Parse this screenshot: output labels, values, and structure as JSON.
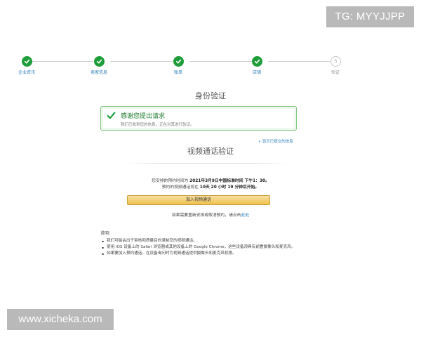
{
  "watermarks": {
    "tg": "TG: MYYJJPP",
    "site": "www.xicheka.com"
  },
  "colors": {
    "success": "#1f9d3a",
    "link": "#2a7fbf",
    "button": "#f0c14b"
  },
  "steps": [
    {
      "label": "企业资讯",
      "status": "done",
      "icon": "check-icon"
    },
    {
      "label": "卖家信息",
      "status": "done",
      "icon": "check-icon"
    },
    {
      "label": "账单",
      "status": "done",
      "icon": "check-icon"
    },
    {
      "label": "店铺",
      "status": "done",
      "icon": "check-icon"
    },
    {
      "label": "验证",
      "status": "pending",
      "number": "5"
    }
  ],
  "identity": {
    "title": "身份验证",
    "success_title": "感谢您提出请求",
    "success_sub": "我们已收到您的信息，正在对其进行验证。",
    "show_info": "∨ 显示已提交的信息"
  },
  "video": {
    "title": "视频通话验证",
    "line1_prefix": "您安排的预约时间为 ",
    "line1_time": "2021年3月9日中国标准时间 下午1：30。",
    "line2_prefix": "预约的视频通话将在 ",
    "line2_countdown": "10天 20 小时 19 分钟后开始。",
    "join_label": "加入视频通话",
    "resched_text": "如果需要重新安排或取消预约，请点击",
    "resched_link": "此处"
  },
  "notes": {
    "title": "说明：",
    "items": [
      "我们可能会出于审核和质量目的录制您的视频通话。",
      "使用 iOS 设备上的 Safari 浏览器或其他设备上的 Google Chrome，这些设备须具有前置摄像头和麦克风。",
      "如果要加入预约通话，在设备询问时为视频通话提供摄像头和麦克风权限。"
    ]
  }
}
